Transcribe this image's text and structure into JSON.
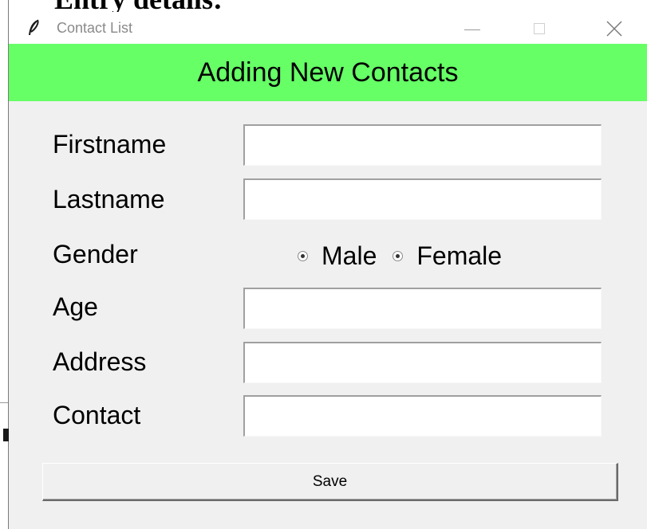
{
  "document": {
    "heading": "Entry details:"
  },
  "window": {
    "title": "Contact List",
    "icon": "feather-icon"
  },
  "form": {
    "banner": "Adding New Contacts",
    "fields": [
      {
        "label": "Firstname",
        "value": ""
      },
      {
        "label": "Lastname",
        "value": ""
      },
      {
        "label": "Gender"
      },
      {
        "label": "Age",
        "value": ""
      },
      {
        "label": "Address",
        "value": ""
      },
      {
        "label": "Contact",
        "value": ""
      }
    ],
    "gender_options": [
      "Male",
      "Female"
    ],
    "save_label": "Save"
  },
  "colors": {
    "banner_bg": "#66ff66",
    "window_bg": "#f0f0f0"
  }
}
